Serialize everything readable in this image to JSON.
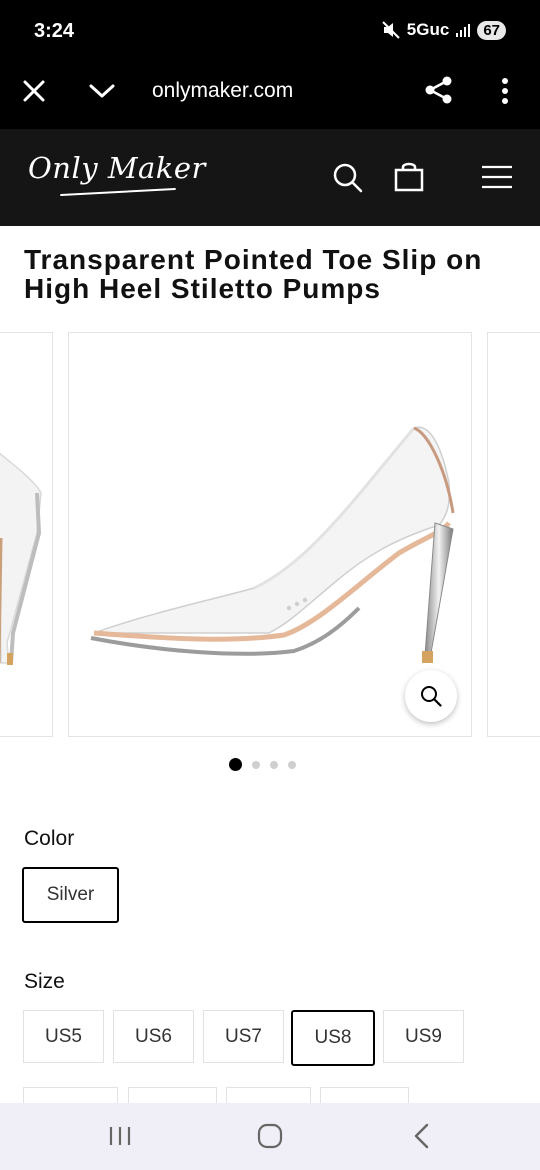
{
  "status_bar": {
    "time": "3:24",
    "network": "5Guc",
    "battery": "67"
  },
  "browser": {
    "url": "onlymaker.com"
  },
  "site": {
    "logo_text": "Only Maker"
  },
  "product": {
    "title": "Transparent Pointed Toe Slip on High Heel Stiletto Pumps",
    "gallery_pages": 4,
    "active_page": 1
  },
  "color_option": {
    "label": "Color",
    "selected": "Silver"
  },
  "size_option": {
    "label": "Size",
    "sizes": [
      "US5",
      "US6",
      "US7",
      "US8",
      "US9"
    ],
    "selected": "US8"
  }
}
